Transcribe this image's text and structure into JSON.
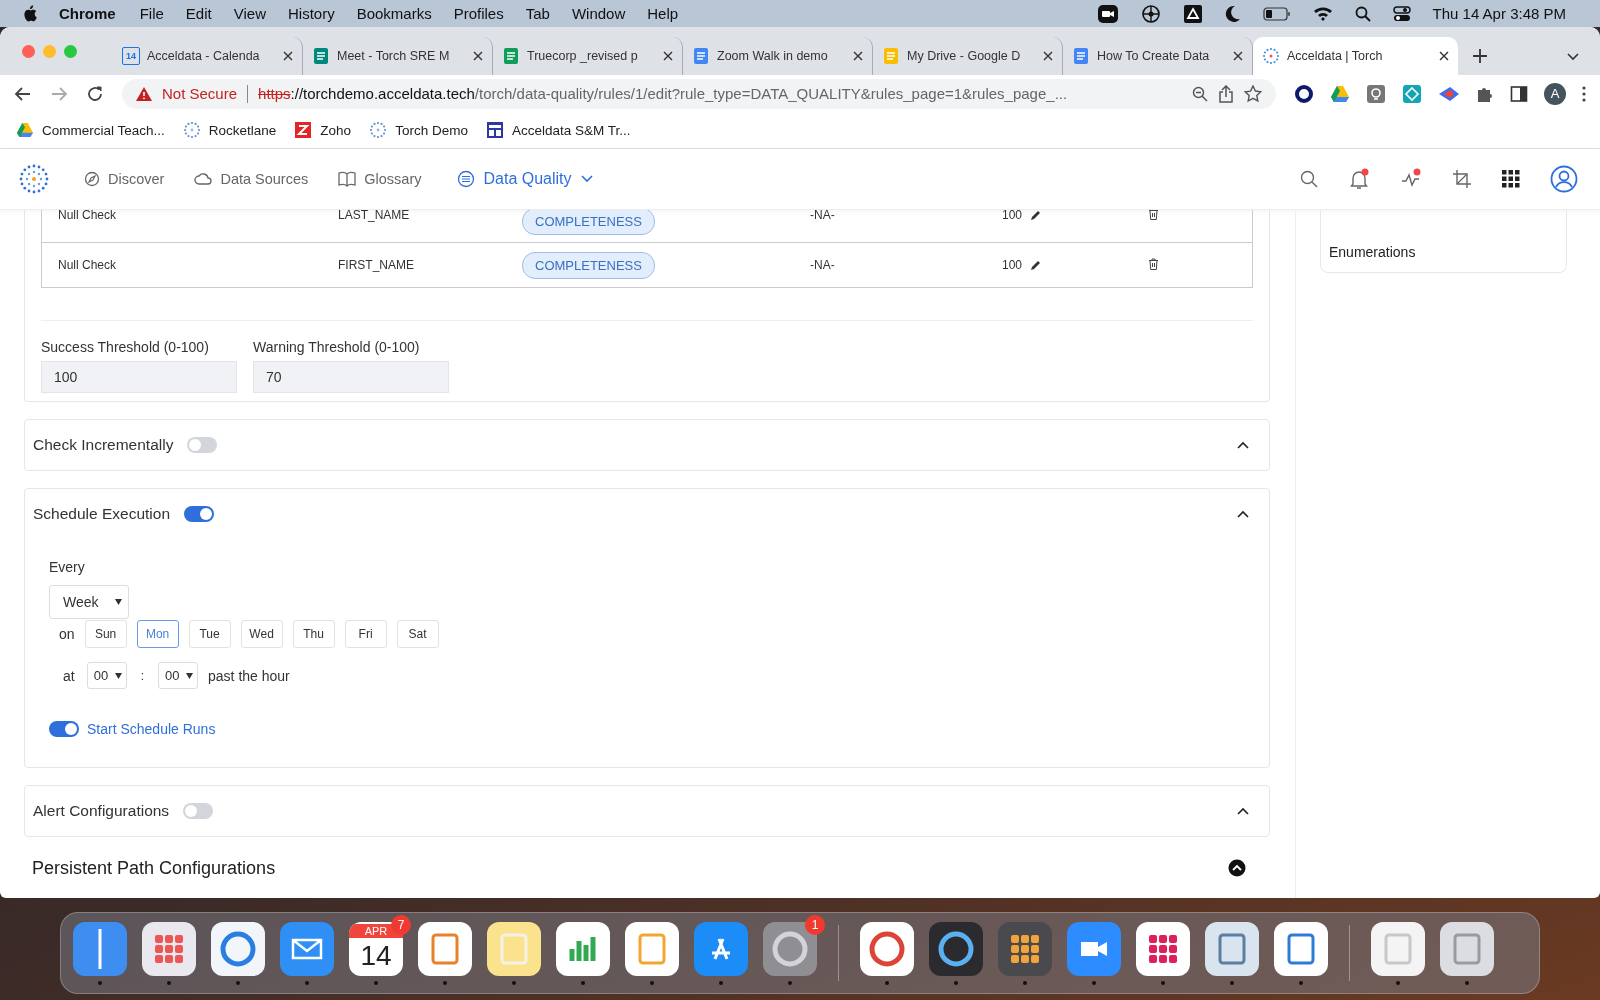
{
  "menubar": {
    "app": "Chrome",
    "menus": [
      "File",
      "Edit",
      "View",
      "History",
      "Bookmarks",
      "Profiles",
      "Tab",
      "Window",
      "Help"
    ],
    "clock": "Thu 14 Apr  3:48 PM"
  },
  "tabs": [
    {
      "title": "Acceldata - Calenda",
      "favicon_text": "14",
      "selected": false
    },
    {
      "title": "Meet - Torch SRE M",
      "selected": false
    },
    {
      "title": "Truecorp _revised p",
      "selected": false
    },
    {
      "title": "Zoom Walk in demo",
      "selected": false
    },
    {
      "title": "My Drive - Google D",
      "selected": false
    },
    {
      "title": "How To Create Data",
      "selected": false
    },
    {
      "title": "Acceldata | Torch",
      "selected": true
    }
  ],
  "address": {
    "warning": "Not Secure",
    "scheme": "https",
    "host": "://torchdemo.acceldata.tech",
    "path": "/torch/data-quality/rules/1/edit?rule_type=DATA_QUALITY&rules_page=1&rules_page_...",
    "avatar": "A"
  },
  "bookmarks": [
    "Commercial Teach...",
    "Rocketlane",
    "Zoho",
    "Torch Demo",
    "Acceldata S&M Tr..."
  ],
  "nav": {
    "items": [
      {
        "label": "Discover",
        "selected": false
      },
      {
        "label": "Data Sources",
        "selected": false
      },
      {
        "label": "Glossary",
        "selected": false
      },
      {
        "label": "Data Quality",
        "selected": true
      }
    ]
  },
  "table": {
    "rows": [
      {
        "check": "Null Check",
        "column": "LAST_NAME",
        "tag": "COMPLETENESS",
        "value": "-NA-",
        "threshold": "100"
      },
      {
        "check": "Null Check",
        "column": "FIRST_NAME",
        "tag": "COMPLETENESS",
        "value": "-NA-",
        "threshold": "100"
      }
    ]
  },
  "thresholds": [
    {
      "label": "Success Threshold (0-100)",
      "value": "100"
    },
    {
      "label": "Warning Threshold (0-100)",
      "value": "70"
    }
  ],
  "sections": [
    {
      "kind": "toggle",
      "title": "Check Incrementally",
      "on": false
    },
    {
      "kind": "schedule",
      "title": "Schedule Execution",
      "on": true
    },
    {
      "kind": "toggle",
      "title": "Alert Configurations",
      "on": false
    }
  ],
  "schedule": {
    "every_label": "Every",
    "frequency": "Week",
    "on_label": "on",
    "days": [
      {
        "label": "Sun",
        "selected": false
      },
      {
        "label": "Mon",
        "selected": true
      },
      {
        "label": "Tue",
        "selected": false
      },
      {
        "label": "Wed",
        "selected": false
      },
      {
        "label": "Thu",
        "selected": false
      },
      {
        "label": "Fri",
        "selected": false
      },
      {
        "label": "Sat",
        "selected": false
      }
    ],
    "at_label": "at",
    "hour": "00",
    "separator": ":",
    "minute": "00",
    "suffix": "past the hour",
    "start_runs": {
      "label": "Start Schedule Runs",
      "on": true
    }
  },
  "persistent": {
    "title": "Persistent Path Configurations"
  },
  "sidebar": {
    "item": "Enumerations"
  },
  "dock": {
    "calendar_month": "APR",
    "calendar_day": "14",
    "items": [
      {
        "kind": "finder"
      },
      {
        "kind": "launchpad"
      },
      {
        "kind": "safari"
      },
      {
        "kind": "mail"
      },
      {
        "kind": "calendar",
        "badge": "7"
      },
      {
        "kind": "reminders"
      },
      {
        "kind": "notes"
      },
      {
        "kind": "numbers"
      },
      {
        "kind": "pages"
      },
      {
        "kind": "appstore"
      },
      {
        "kind": "settings",
        "badge": "1"
      },
      {
        "kind": "separator"
      },
      {
        "kind": "chrome"
      },
      {
        "kind": "quicktime"
      },
      {
        "kind": "calculator"
      },
      {
        "kind": "zoom"
      },
      {
        "kind": "slack"
      },
      {
        "kind": "preview"
      },
      {
        "kind": "keynote"
      },
      {
        "kind": "separator"
      },
      {
        "kind": "document"
      },
      {
        "kind": "trash"
      }
    ]
  }
}
